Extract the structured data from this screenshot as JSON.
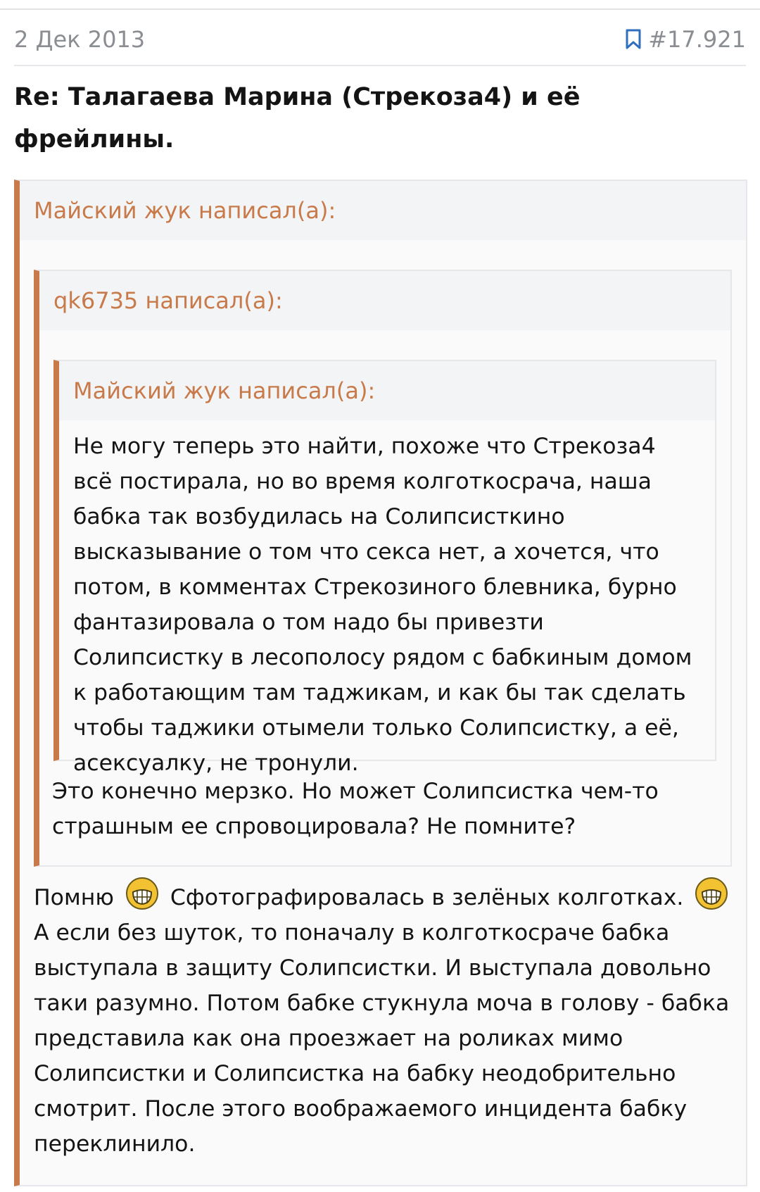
{
  "post": {
    "date": "2 Дек 2013",
    "number": "#17.921",
    "title": "Re: Талагаева Марина (Стрекоза4) и её фрейлины."
  },
  "quotes": {
    "outer": {
      "author": "Майский жук написал(а):",
      "body_before": "Помню",
      "body_middle": "Сфотографировалась в зелёных колготках.",
      "body_after": "А если без шуток, то поначалу в колготкосраче бабка выступала в защиту Солипсистки. И выступала довольно таки разумно. Потом бабке стукнула моча в голову - бабка представила как она проезжает на роликах мимо Солипсистки и Солипсистка на бабку неодобрительно смотрит. После этого воображаемого инцидента бабку переклинило."
    },
    "middle": {
      "author": "qk6735 написал(а):",
      "body": "Это конечно мерзко. Но может Солипсистка чем-то страшным ее спровоцировала? Не помните?"
    },
    "inner": {
      "author": "Майский жук написал(а):",
      "body": "Не могу теперь это найти, похоже что Стрекоза4 всё постирала, но во время колготкосрача, наша бабка так возбудилась на Солипсисткино высказывание о том что секса нет, а хочется, что потом, в комментах Стрекозиного блевника, бурно фантазировала о том надо бы привезти Солипсистку в лесополосу рядом с бабкиным домом к работающим там таджикам, и как бы так сделать чтобы таджики отымели только Солипсистку, а её, асексуалку, не тронули."
    }
  },
  "icons": {
    "bookmark": "bookmark-icon",
    "emoji": "grinning-emoji-icon"
  },
  "colors": {
    "quote_accent": "#c87a4a",
    "meta_text": "#8a8d91"
  }
}
